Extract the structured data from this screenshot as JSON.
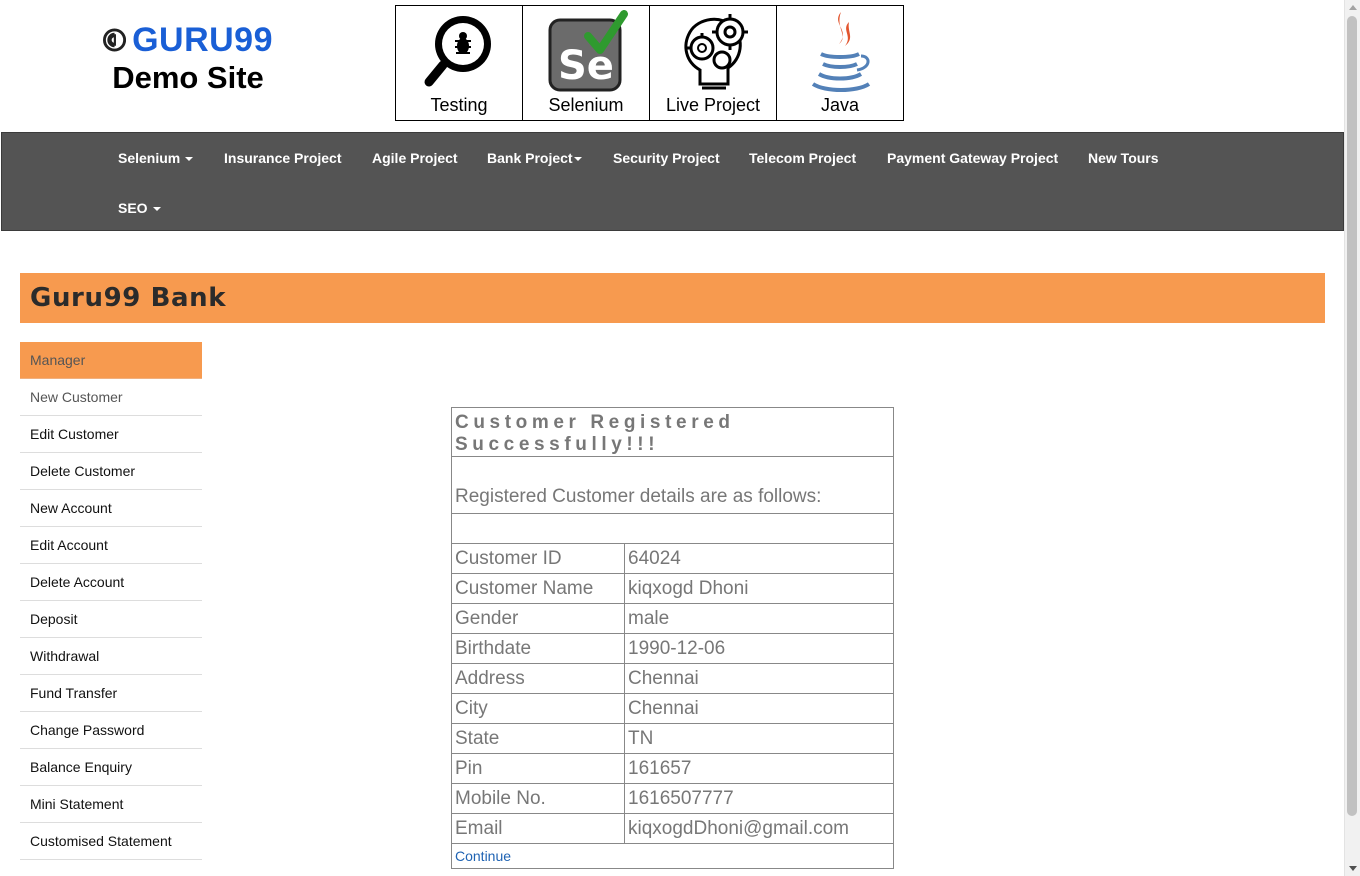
{
  "header": {
    "brand": "GURU99",
    "site_title": "Demo Site",
    "topics": [
      {
        "label": "Testing",
        "icon": "magnifier-bug-icon"
      },
      {
        "label": "Selenium",
        "icon": "selenium-check-icon"
      },
      {
        "label": "Live Project",
        "icon": "gear-bulb-icon"
      },
      {
        "label": "Java",
        "icon": "java-cup-icon"
      }
    ]
  },
  "nav": {
    "items": [
      "Selenium",
      "Insurance Project",
      "Agile Project",
      "Bank Project",
      "Security Project",
      "Telecom Project",
      "Payment Gateway Project",
      "New Tours",
      "SEO"
    ]
  },
  "bank": {
    "title": "Guru99 Bank"
  },
  "sidebar": {
    "items": [
      "Manager",
      "New Customer",
      "Edit Customer",
      "Delete Customer",
      "New Account",
      "Edit Account",
      "Delete Account",
      "Deposit",
      "Withdrawal",
      "Fund Transfer",
      "Change Password",
      "Balance Enquiry",
      "Mini Statement",
      "Customised Statement"
    ]
  },
  "registration": {
    "success_message": "Customer Registered Successfully!!!",
    "details_heading": "Registered Customer details are as follows:",
    "rows": [
      {
        "label": "Customer ID",
        "value": "64024"
      },
      {
        "label": "Customer Name",
        "value": "kiqxogd Dhoni"
      },
      {
        "label": "Gender",
        "value": "male"
      },
      {
        "label": "Birthdate",
        "value": "1990-12-06"
      },
      {
        "label": "Address",
        "value": "Chennai"
      },
      {
        "label": "City",
        "value": "Chennai"
      },
      {
        "label": "State",
        "value": "TN"
      },
      {
        "label": "Pin",
        "value": "161657"
      },
      {
        "label": "Mobile No.",
        "value": "1616507777"
      },
      {
        "label": "Email",
        "value": "kiqxogdDhoni@gmail.com"
      }
    ],
    "continue_label": "Continue"
  },
  "colors": {
    "accent_orange": "#f79a4f",
    "nav_bg": "#545454",
    "success_green": "#3e7d0c",
    "brand_blue": "#1a5fd6",
    "link_blue": "#1f63b3"
  }
}
